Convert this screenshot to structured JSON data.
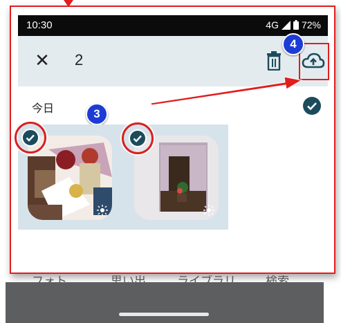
{
  "status_bar": {
    "time": "10:30",
    "network": "4G",
    "battery": "72%"
  },
  "toolbar": {
    "close_label": "✕",
    "selected_count": "2"
  },
  "section": {
    "date_label": "今日"
  },
  "badges": {
    "step_upload": "4",
    "step_select": "3"
  },
  "photos": [
    {
      "id": "photo-1",
      "selected": true
    },
    {
      "id": "photo-2",
      "selected": true
    }
  ],
  "bottom_nav": {
    "items": [
      "フォト",
      "思い出",
      "ライブラリ",
      "検索"
    ]
  },
  "colors": {
    "annotation_red": "#e11d1d",
    "badge_blue": "#1d3cd6",
    "check_teal": "#1c4c5c",
    "toolbar_bg": "#e4ebef"
  }
}
